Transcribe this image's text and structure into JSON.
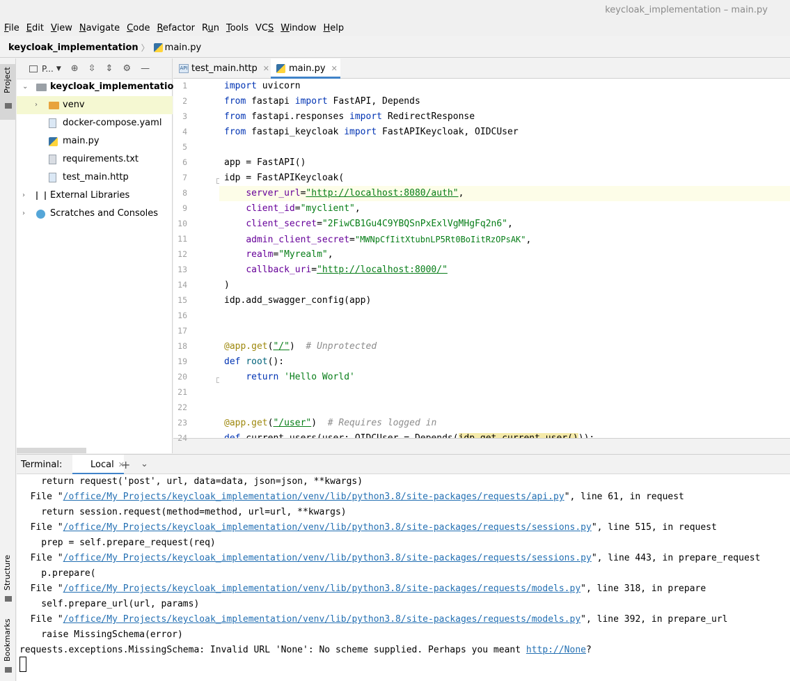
{
  "window": {
    "title": "keycloak_implementation – main.py"
  },
  "menu": [
    {
      "pre": "",
      "u": "F",
      "post": "ile"
    },
    {
      "pre": "",
      "u": "E",
      "post": "dit"
    },
    {
      "pre": "",
      "u": "V",
      "post": "iew"
    },
    {
      "pre": "",
      "u": "N",
      "post": "avigate"
    },
    {
      "pre": "",
      "u": "C",
      "post": "ode"
    },
    {
      "pre": "",
      "u": "R",
      "post": "efactor"
    },
    {
      "pre": "R",
      "u": "u",
      "post": "n"
    },
    {
      "pre": "",
      "u": "T",
      "post": "ools"
    },
    {
      "pre": "VC",
      "u": "S",
      "post": ""
    },
    {
      "pre": "",
      "u": "W",
      "post": "indow"
    },
    {
      "pre": "",
      "u": "H",
      "post": "elp"
    }
  ],
  "breadcrumb": {
    "project": "keycloak_implementation",
    "file": "main.py"
  },
  "left_strip": {
    "project": "Project",
    "structure": "Structure",
    "bookmarks": "Bookmarks"
  },
  "project_panel": {
    "dropdown": "P...",
    "tree": [
      {
        "label": "keycloak_implementation",
        "suffix": " /",
        "bold": true
      },
      {
        "label": "venv"
      },
      {
        "label": "docker-compose.yaml"
      },
      {
        "label": "main.py"
      },
      {
        "label": "requirements.txt"
      },
      {
        "label": "test_main.http"
      },
      {
        "label": "External Libraries"
      },
      {
        "label": "Scratches and Consoles"
      }
    ]
  },
  "editor": {
    "tabs": [
      {
        "label": "test_main.http"
      },
      {
        "label": "main.py"
      }
    ],
    "line_numbers": [
      "1",
      "2",
      "3",
      "4",
      "5",
      "6",
      "7",
      "8",
      "9",
      "10",
      "11",
      "12",
      "13",
      "14",
      "15",
      "16",
      "17",
      "18",
      "19",
      "20",
      "21",
      "22",
      "23",
      "24"
    ],
    "code": {
      "l1": [
        "import",
        " uvicorn"
      ],
      "l2": [
        "from",
        " fastapi ",
        "import",
        " FastAPI, Depends"
      ],
      "l3": [
        "from",
        " fastapi.responses ",
        "import",
        " RedirectResponse"
      ],
      "l4": [
        "from",
        " fastapi_keycloak ",
        "import",
        " FastAPIKeycloak, OIDCUser"
      ],
      "l6": "app = FastAPI()",
      "l7": "idp = FastAPIKeycloak(",
      "l8": [
        "    ",
        "server_url",
        "=",
        "\"http://localhost:8080/auth\"",
        ","
      ],
      "l9": [
        "    ",
        "client_id",
        "=",
        "\"myclient\"",
        ","
      ],
      "l10": [
        "    ",
        "client_secret",
        "=",
        "\"2FiwCB1Gu4C9YBQSnPxExlVgMHgFq2n6\"",
        ","
      ],
      "l11": [
        "    ",
        "admin_client_secret",
        "=",
        "\"MWNpCfIitXtubnLP5Rt0BoIitRzOPsAK\"",
        ","
      ],
      "l12": [
        "    ",
        "realm",
        "=",
        "\"Myrealm\"",
        ","
      ],
      "l13": [
        "    ",
        "callback_uri",
        "=",
        "\"http://localhost:8000/\""
      ],
      "l14": ")",
      "l15": "idp.add_swagger_config(app)",
      "l18": [
        "@app.get",
        "(",
        "\"/\"",
        ")  ",
        "# Unprotected"
      ],
      "l19": [
        "def",
        " ",
        "root",
        "():"
      ],
      "l20": [
        "    ",
        "return",
        " ",
        "'Hello World'"
      ],
      "l23": [
        "@app.get",
        "(",
        "\"/user\"",
        ")  ",
        "# Requires logged in"
      ],
      "l24": [
        "def",
        " current_users(user: OIDCUser = Depends(",
        "idp.get_current_user()",
        ")):"
      ]
    }
  },
  "terminal": {
    "label": "Terminal:",
    "tab": "Local",
    "lines": [
      {
        "a": "    return request('post', url, data=data, json=json, **kwargs)"
      },
      {
        "a": "  File \"",
        "link": "/office/My Projects/keycloak_implementation/venv/lib/python3.8/site-packages/requests/api.py",
        "b": "\", line 61, in request"
      },
      {
        "a": "    return session.request(method=method, url=url, **kwargs)"
      },
      {
        "a": "  File \"",
        "link": "/office/My Projects/keycloak_implementation/venv/lib/python3.8/site-packages/requests/sessions.py",
        "b": "\", line 515, in request"
      },
      {
        "a": "    prep = self.prepare_request(req)"
      },
      {
        "a": "  File \"",
        "link": "/office/My Projects/keycloak_implementation/venv/lib/python3.8/site-packages/requests/sessions.py",
        "b": "\", line 443, in prepare_request"
      },
      {
        "a": "    p.prepare("
      },
      {
        "a": "  File \"",
        "link": "/office/My Projects/keycloak_implementation/venv/lib/python3.8/site-packages/requests/models.py",
        "b": "\", line 318, in prepare"
      },
      {
        "a": "    self.prepare_url(url, params)"
      },
      {
        "a": "  File \"",
        "link": "/office/My Projects/keycloak_implementation/venv/lib/python3.8/site-packages/requests/models.py",
        "b": "\", line 392, in prepare_url"
      },
      {
        "a": "    raise MissingSchema(error)"
      },
      {
        "a": "requests.exceptions.MissingSchema: Invalid URL 'None': No scheme supplied. Perhaps you meant ",
        "link": "http://None",
        "b": "?"
      }
    ]
  }
}
